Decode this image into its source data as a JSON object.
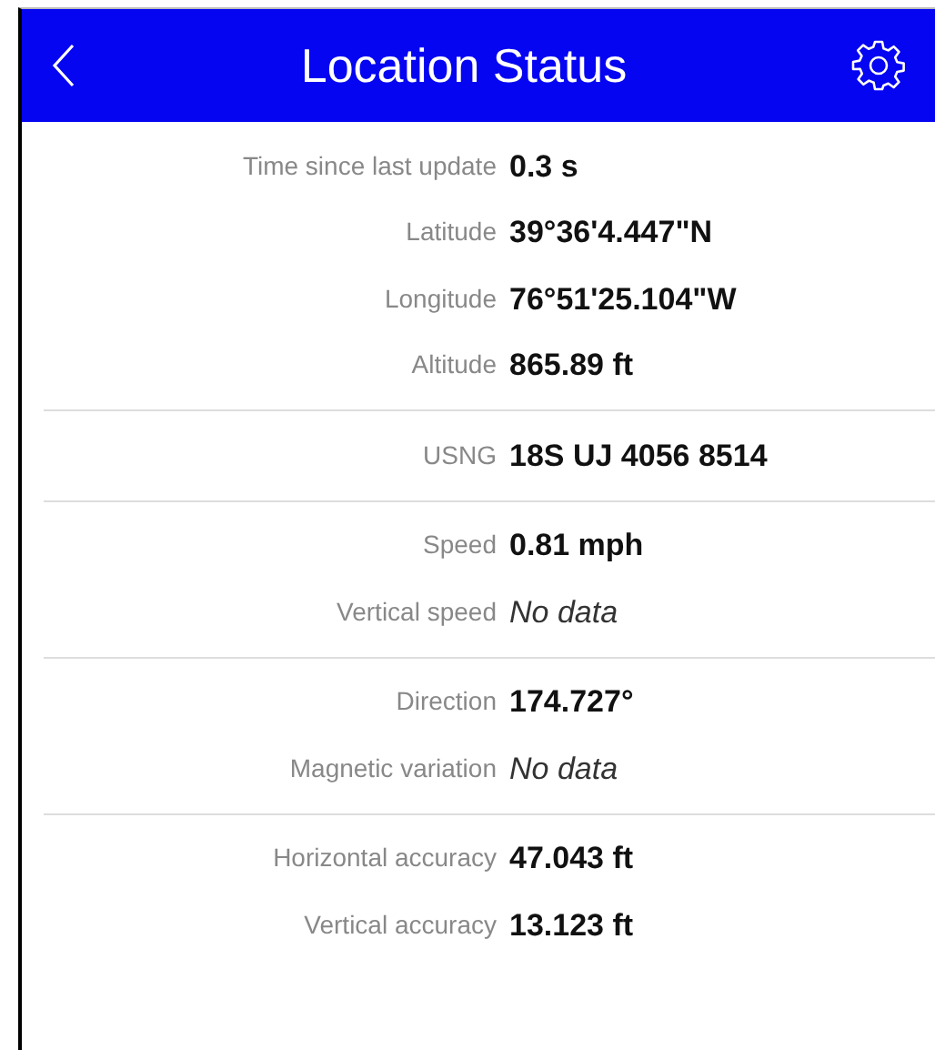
{
  "header": {
    "title": "Location Status"
  },
  "sections": [
    {
      "rows": [
        {
          "label": "Time since last update",
          "value": "0.3 s",
          "kind": "data"
        },
        {
          "label": "Latitude",
          "value": "39°36'4.447\"N",
          "kind": "data"
        },
        {
          "label": "Longitude",
          "value": "76°51'25.104\"W",
          "kind": "data"
        },
        {
          "label": "Altitude",
          "value": "865.89 ft",
          "kind": "data"
        }
      ]
    },
    {
      "rows": [
        {
          "label": "USNG",
          "value": "18S UJ 4056 8514",
          "kind": "data"
        }
      ]
    },
    {
      "rows": [
        {
          "label": "Speed",
          "value": "0.81 mph",
          "kind": "data"
        },
        {
          "label": "Vertical speed",
          "value": "No data",
          "kind": "missing"
        }
      ]
    },
    {
      "rows": [
        {
          "label": "Direction",
          "value": "174.727°",
          "kind": "data"
        },
        {
          "label": "Magnetic variation",
          "value": "No data",
          "kind": "missing"
        }
      ]
    },
    {
      "rows": [
        {
          "label": "Horizontal accuracy",
          "value": "47.043 ft",
          "kind": "data"
        },
        {
          "label": "Vertical accuracy",
          "value": "13.123 ft",
          "kind": "data"
        }
      ]
    }
  ]
}
